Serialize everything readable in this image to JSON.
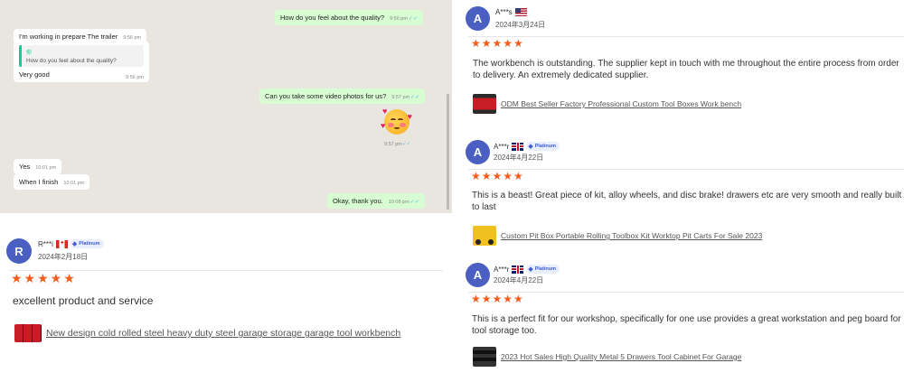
{
  "chat": {
    "messages": [
      {
        "dir": "out",
        "text": "How do you feel about the quality?",
        "time": "9:56 pm"
      },
      {
        "dir": "in",
        "text": "I'm working in prepare The trailer",
        "time": "9:56 pm"
      },
      {
        "dir": "in",
        "quote_name": "你",
        "quote_text": "How do you feel about the quality?",
        "text": "Very good",
        "time": "9:56 pm"
      },
      {
        "dir": "out",
        "text": "Can you take some video photos for us?",
        "time": "9:57 pm"
      },
      {
        "dir": "out",
        "emoji": "smiling-face-with-hearts",
        "time": "9:57 pm"
      },
      {
        "dir": "in",
        "text": "Yes",
        "time": "10:01 pm"
      },
      {
        "dir": "in",
        "text": "When I finish",
        "time": "10:01 pm"
      },
      {
        "dir": "out",
        "text": "Okay, thank you.",
        "time": "10:08 pm"
      }
    ]
  },
  "reviews": [
    {
      "avatar_letter": "A",
      "name": "A***s",
      "flag": "us",
      "date": "2024年3月24日",
      "stars": "★★★★★",
      "text": "The workbench is outstanding. The supplier kept in touch with me throughout the entire process from order to delivery. An extremely dedicated supplier.",
      "product": "ODM Best Seller Factory Professional Custom Tool Boxes Work bench"
    },
    {
      "avatar_letter": "A",
      "name": "A***r",
      "flag": "uk",
      "badge": "Platinum",
      "date": "2024年4月22日",
      "stars": "★★★★★",
      "text": "This is a beast! Great piece of kit, alloy wheels, and disc brake! drawers etc are very smooth and really built to last",
      "product": "Custom Pit Box Portable Rolling Toolbox Kit Worktop Pit Carts For Sale 2023"
    },
    {
      "avatar_letter": "A",
      "name": "A***r",
      "flag": "uk",
      "badge": "Platinum",
      "date": "2024年4月22日",
      "stars": "★★★★★",
      "text": "This is a perfect fit for our workshop, specifically for one use provides a great workstation and peg board for tool storage too.",
      "product": "2023 Hot Sales High Quality Metal 5 Drawers Tool Cabinet For Garage"
    },
    {
      "avatar_letter": "R",
      "name": "R***i",
      "flag": "ca",
      "badge": "Platinum",
      "date": "2024年2月18日",
      "stars": "★★★★★",
      "text": "excellent product and service",
      "product": "New design cold rolled steel heavy duty steel garage storage garage tool workbench"
    }
  ],
  "colors": {
    "avatar": "#4a5fc1",
    "stars": "#f25c1c",
    "chat_bg": "#e9e5df",
    "outgoing_bubble": "#d9fdd3",
    "badge": "#3b5bd6"
  }
}
